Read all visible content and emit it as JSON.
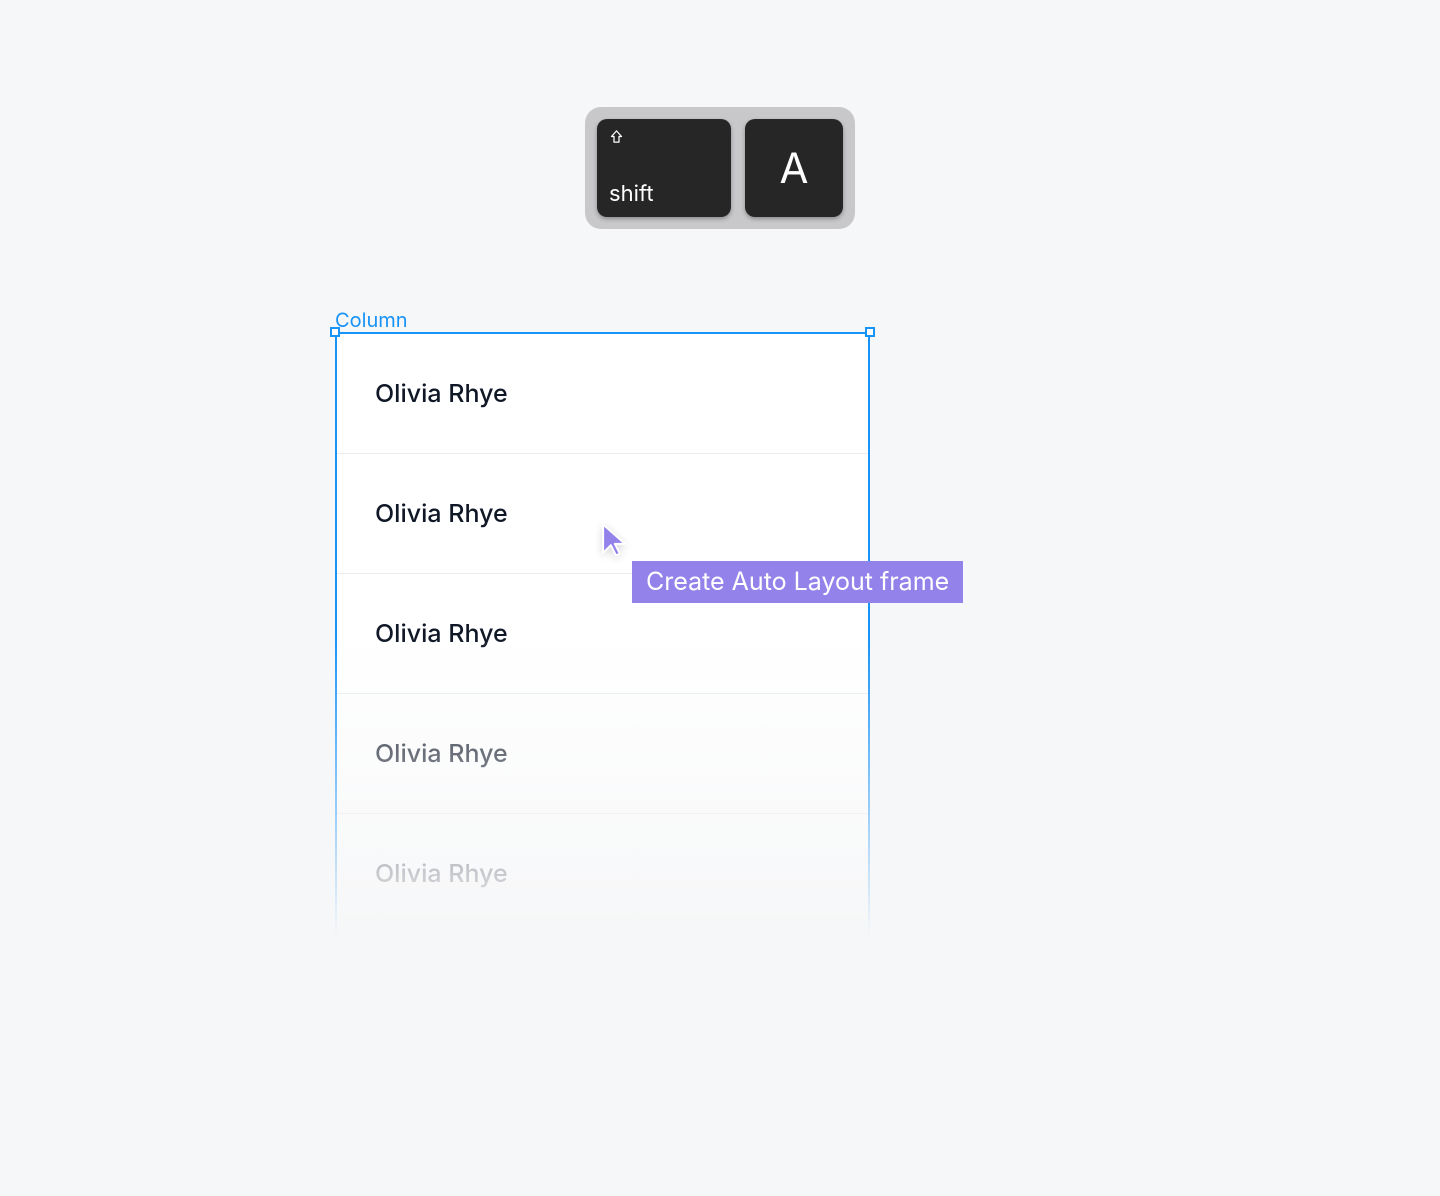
{
  "keyboard": {
    "modifier": "shift",
    "key": "A"
  },
  "frame": {
    "label": "Column",
    "rows": [
      "Olivia Rhye",
      "Olivia Rhye",
      "Olivia Rhye",
      "Olivia Rhye",
      "Olivia Rhye"
    ]
  },
  "tooltip": {
    "text": "Create Auto Layout frame"
  },
  "colors": {
    "selection": "#1893F8",
    "cursor": "#9282E9",
    "tooltip_bg": "#9282E9",
    "key_bg": "#262626",
    "keyboard_tray": "#C8C8CA"
  }
}
